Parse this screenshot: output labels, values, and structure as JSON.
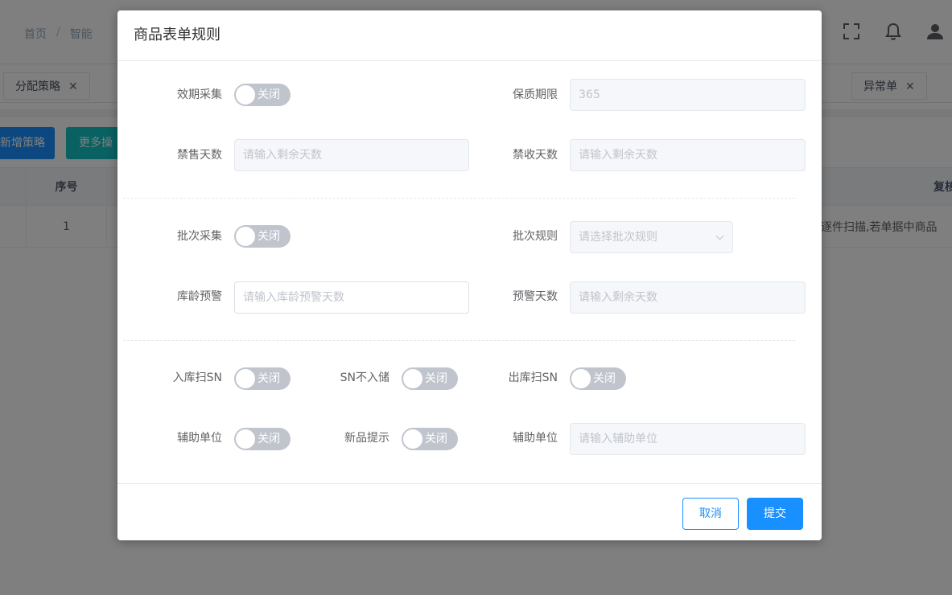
{
  "topbar": {
    "breadcrumb": [
      "首页",
      "智能"
    ],
    "breadcrumb_sep": "/",
    "icons": [
      "fullscreen-icon",
      "bell-icon",
      "user-icon"
    ]
  },
  "tabs": [
    {
      "label": "分配策略",
      "close": "✕"
    },
    {
      "label": "异常单",
      "close": "✕"
    }
  ],
  "toolbar": {
    "add_label": "新增策略",
    "more_label": "更多操"
  },
  "table": {
    "headers": [
      "序号",
      "复核"
    ],
    "row": {
      "index": "1",
      "desc": "逐件扫描,若单据中商品"
    }
  },
  "dialog": {
    "title": "商品表单规则",
    "fields": {
      "expiry_collect": {
        "label": "效期采集",
        "switch": "关闭"
      },
      "shelf_life": {
        "label": "保质期限",
        "value": "365"
      },
      "no_sale_days": {
        "label": "禁售天数",
        "placeholder": "请输入剩余天数"
      },
      "no_receive_days": {
        "label": "禁收天数",
        "placeholder": "请输入剩余天数"
      },
      "batch_collect": {
        "label": "批次采集",
        "switch": "关闭"
      },
      "batch_rule": {
        "label": "批次规则",
        "placeholder": "请选择批次规则"
      },
      "age_warning": {
        "label": "库龄预警",
        "placeholder": "请输入库龄预警天数"
      },
      "warning_days": {
        "label": "预警天数",
        "placeholder": "请输入剩余天数"
      },
      "inbound_sn": {
        "label": "入库扫SN",
        "switch": "关闭"
      },
      "sn_no_store": {
        "label": "SN不入储",
        "switch": "关闭"
      },
      "outbound_sn": {
        "label": "出库扫SN",
        "switch": "关闭"
      },
      "aux_unit_switch": {
        "label": "辅助单位",
        "switch": "关闭"
      },
      "new_product_tip": {
        "label": "新品提示",
        "switch": "关闭"
      },
      "aux_unit": {
        "label": "辅助单位",
        "placeholder": "请输入辅助单位"
      }
    },
    "cancel_label": "取消",
    "submit_label": "提交"
  },
  "colors": {
    "primary": "#1890ff",
    "switch_off": "#c0c4cc",
    "overlay": "rgba(0,0,0,0.5)"
  }
}
